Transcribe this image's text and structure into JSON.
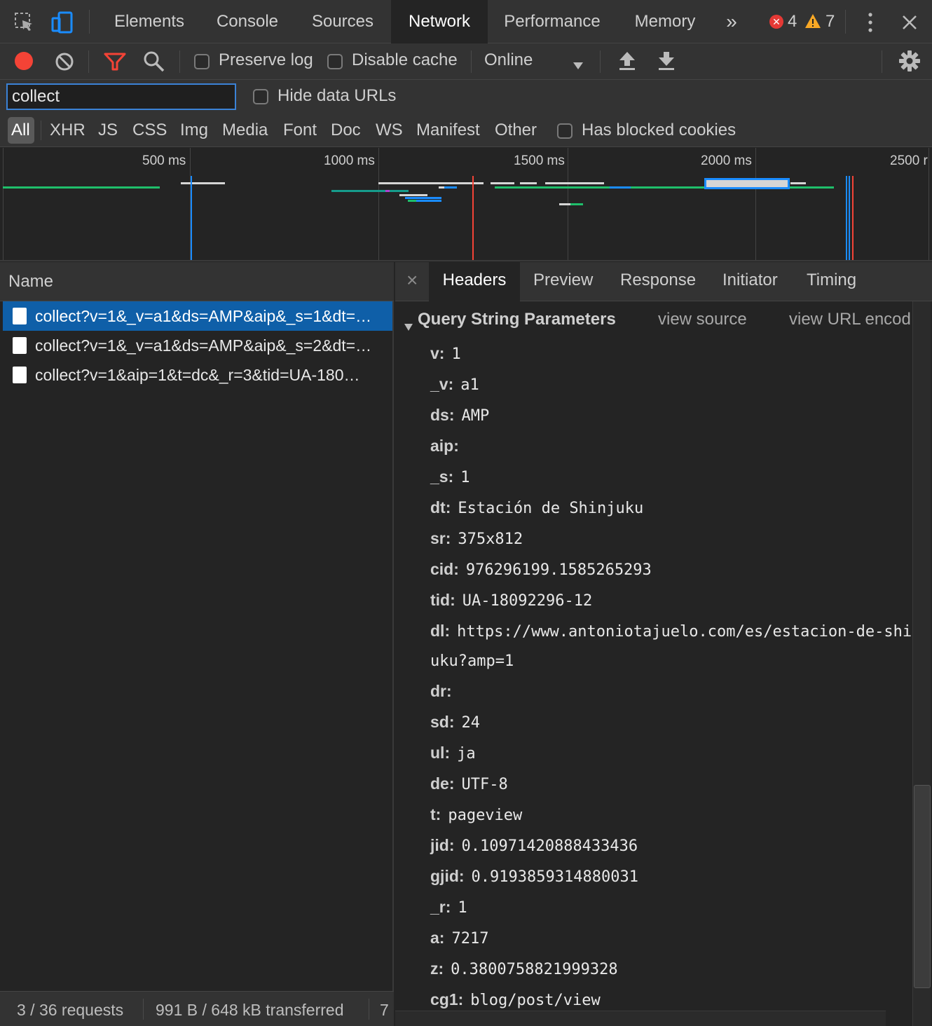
{
  "tabs": {
    "items": [
      "Elements",
      "Console",
      "Sources",
      "Network",
      "Performance",
      "Memory"
    ],
    "active": "Network",
    "more": "»",
    "error_count": "4",
    "warning_count": "7"
  },
  "toolbar": {
    "preserve_log": "Preserve log",
    "disable_cache": "Disable cache",
    "throttle": "Online"
  },
  "filter": {
    "value": "collect",
    "hide_data_urls": "Hide data URLs",
    "types": [
      "All",
      "XHR",
      "JS",
      "CSS",
      "Img",
      "Media",
      "Font",
      "Doc",
      "WS",
      "Manifest",
      "Other"
    ],
    "active_type": "All",
    "has_blocked_cookies": "Has blocked cookies"
  },
  "overview": {
    "ticks": [
      "500 ms",
      "1000 ms",
      "1500 ms",
      "2000 ms",
      "2500 r"
    ]
  },
  "requests": {
    "column": "Name",
    "rows": [
      "collect?v=1&_v=a1&ds=AMP&aip&_s=1&dt=…",
      "collect?v=1&_v=a1&ds=AMP&aip&_s=2&dt=…",
      "collect?v=1&aip=1&t=dc&_r=3&tid=UA-180…"
    ],
    "selected_index": 0
  },
  "status": {
    "requests": "3 / 36 requests",
    "transferred": "991 B / 648 kB transferred",
    "extra": "7"
  },
  "details": {
    "close": "×",
    "tabs": [
      "Headers",
      "Preview",
      "Response",
      "Initiator",
      "Timing"
    ],
    "active_tab": "Headers",
    "section_title": "Query String Parameters",
    "view_source": "view source",
    "view_url_encoded": "view URL encod",
    "params": [
      {
        "key": "v:",
        "value": "1"
      },
      {
        "key": "_v:",
        "value": "a1"
      },
      {
        "key": "ds:",
        "value": "AMP"
      },
      {
        "key": "aip:",
        "value": ""
      },
      {
        "key": "_s:",
        "value": "1"
      },
      {
        "key": "dt:",
        "value": "Estación de Shinjuku"
      },
      {
        "key": "sr:",
        "value": "375x812"
      },
      {
        "key": "cid:",
        "value": "976296199.1585265293"
      },
      {
        "key": "tid:",
        "value": "UA-18092296-12"
      },
      {
        "key": "dl:",
        "value": "https://www.antoniotajuelo.com/es/estacion-de-shi"
      },
      {
        "key": "",
        "value": "uku?amp=1"
      },
      {
        "key": "dr:",
        "value": ""
      },
      {
        "key": "sd:",
        "value": "24"
      },
      {
        "key": "ul:",
        "value": "ja"
      },
      {
        "key": "de:",
        "value": "UTF-8"
      },
      {
        "key": "t:",
        "value": "pageview"
      },
      {
        "key": "jid:",
        "value": "0.10971420888433436"
      },
      {
        "key": "gjid:",
        "value": "0.9193859314880031"
      },
      {
        "key": "_r:",
        "value": "1"
      },
      {
        "key": "a:",
        "value": "7217"
      },
      {
        "key": "z:",
        "value": "0.3800758821999328"
      },
      {
        "key": "cg1:",
        "value": "blog/post/view"
      }
    ]
  },
  "colors": {
    "accent": "#0f5fa8",
    "record": "#f44336",
    "filter_active": "#f44336",
    "error": "#e53935",
    "warning": "#f9a825"
  }
}
